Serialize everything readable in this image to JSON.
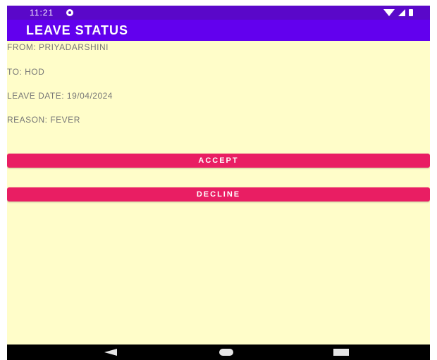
{
  "status_bar": {
    "time": "11:21",
    "app_icon": "notification-app-icon",
    "icons": [
      "wifi-icon",
      "signal-icon",
      "battery-icon"
    ]
  },
  "app_bar": {
    "title": "LEAVE STATUS",
    "color": "#6200ee"
  },
  "leave": {
    "from": "FROM: PRIYADARSHINI",
    "to": "TO: HOD",
    "date": "LEAVE DATE: 19/04/2024",
    "reason": "REASON: FEVER"
  },
  "actions": {
    "accept_label": "ACCEPT",
    "decline_label": "DECLINE",
    "button_color": "#e91e63"
  },
  "nav_bar": {
    "icons": [
      "back-icon",
      "home-icon",
      "recents-icon"
    ]
  },
  "colors": {
    "background": "#fffdc9",
    "status_bar": "#5a08c9"
  }
}
